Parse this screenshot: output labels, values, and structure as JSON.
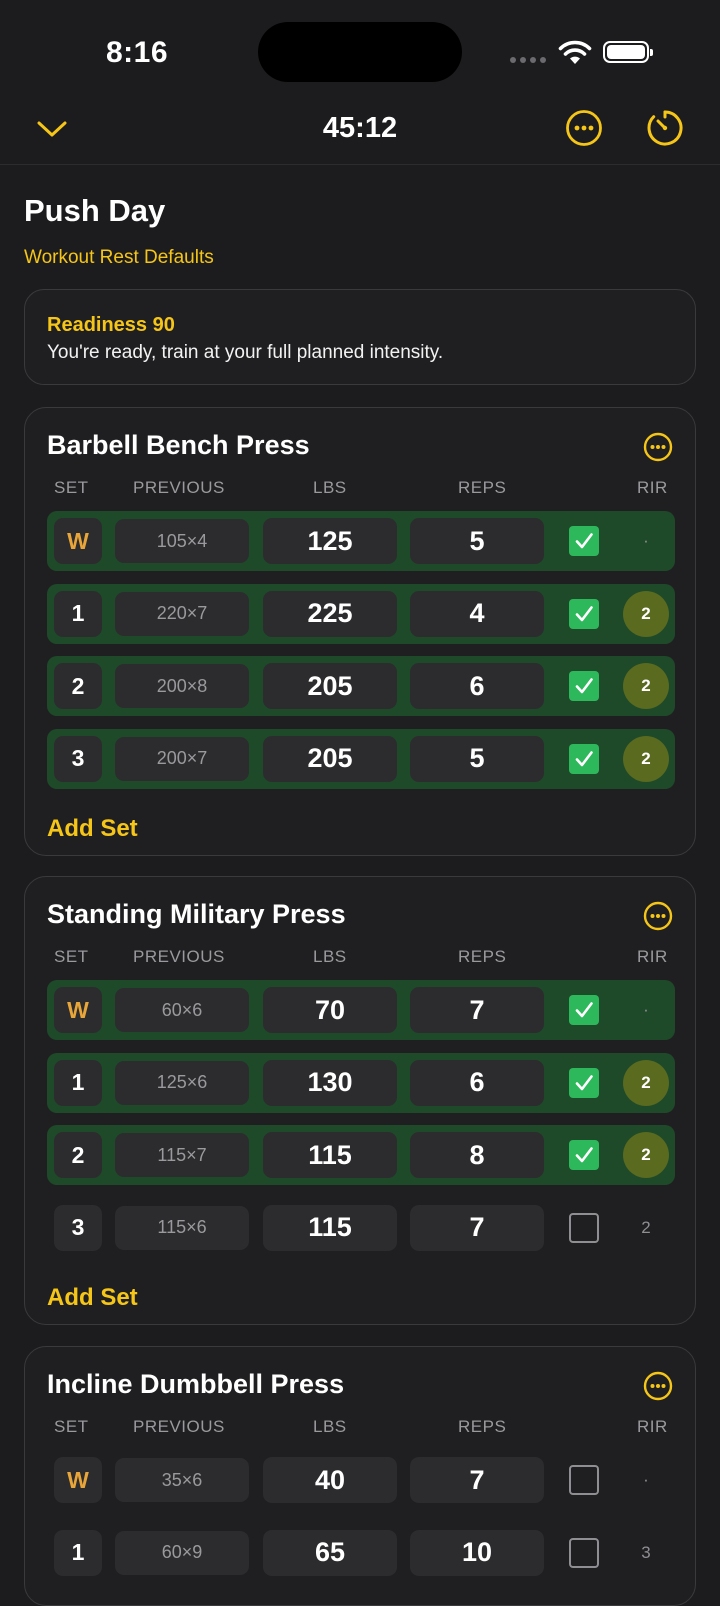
{
  "status_bar": {
    "time": "8:16"
  },
  "navbar": {
    "timer": "45:12"
  },
  "workout": {
    "title": "Push Day",
    "rest_link": "Workout Rest Defaults"
  },
  "readiness": {
    "title": "Readiness 90",
    "description": "You're ready, train at your full planned intensity."
  },
  "columns": {
    "set": "SET",
    "previous": "PREVIOUS",
    "lbs": "LBS",
    "reps": "REPS",
    "rir": "RIR"
  },
  "add_set_label": "Add Set",
  "colors": {
    "accent": "#f5c518",
    "done_row": "#1e4a29",
    "check": "#2eb85c",
    "rir_badge": "#5a6a1f",
    "warmup": "#e8a53a"
  },
  "exercises": [
    {
      "name": "Barbell Bench Press",
      "sets": [
        {
          "set": "W",
          "previous": "105×4",
          "lbs": "125",
          "reps": "5",
          "done": true,
          "rir": "·"
        },
        {
          "set": "1",
          "previous": "220×7",
          "lbs": "225",
          "reps": "4",
          "done": true,
          "rir": "2"
        },
        {
          "set": "2",
          "previous": "200×8",
          "lbs": "205",
          "reps": "6",
          "done": true,
          "rir": "2"
        },
        {
          "set": "3",
          "previous": "200×7",
          "lbs": "205",
          "reps": "5",
          "done": true,
          "rir": "2"
        }
      ]
    },
    {
      "name": "Standing Military Press",
      "sets": [
        {
          "set": "W",
          "previous": "60×6",
          "lbs": "70",
          "reps": "7",
          "done": true,
          "rir": "·"
        },
        {
          "set": "1",
          "previous": "125×6",
          "lbs": "130",
          "reps": "6",
          "done": true,
          "rir": "2"
        },
        {
          "set": "2",
          "previous": "115×7",
          "lbs": "115",
          "reps": "8",
          "done": true,
          "rir": "2"
        },
        {
          "set": "3",
          "previous": "115×6",
          "lbs": "115",
          "reps": "7",
          "done": false,
          "rir": "2"
        }
      ]
    },
    {
      "name": "Incline Dumbbell Press",
      "sets": [
        {
          "set": "W",
          "previous": "35×6",
          "lbs": "40",
          "reps": "7",
          "done": false,
          "rir": "·"
        },
        {
          "set": "1",
          "previous": "60×9",
          "lbs": "65",
          "reps": "10",
          "done": false,
          "rir": "3"
        }
      ]
    }
  ]
}
